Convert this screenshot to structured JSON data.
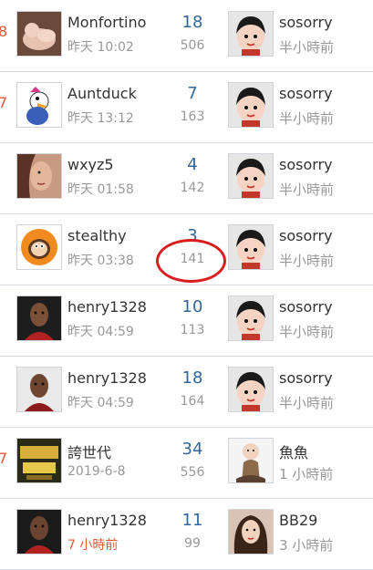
{
  "threads": [
    {
      "author": "Monfortino",
      "date": "昨天 10:02",
      "replies": "18",
      "views": "506",
      "last_user": "sosorry",
      "last_time": "半小時前",
      "edge_mark": "8"
    },
    {
      "author": "Auntduck",
      "date": "昨天 13:12",
      "replies": "7",
      "views": "163",
      "last_user": "sosorry",
      "last_time": "半小時前",
      "edge_mark": "7"
    },
    {
      "author": "wxyz5",
      "date": "昨天 01:58",
      "replies": "4",
      "views": "142",
      "last_user": "sosorry",
      "last_time": "半小時前",
      "edge_mark": ""
    },
    {
      "author": "stealthy",
      "date": "昨天 03:38",
      "replies": "3",
      "views": "141",
      "last_user": "sosorry",
      "last_time": "半小時前",
      "edge_mark": ""
    },
    {
      "author": "henry1328",
      "date": "昨天 04:59",
      "replies": "10",
      "views": "113",
      "last_user": "sosorry",
      "last_time": "半小時前",
      "edge_mark": ""
    },
    {
      "author": "henry1328",
      "date": "昨天 04:59",
      "replies": "18",
      "views": "164",
      "last_user": "sosorry",
      "last_time": "半小時前",
      "edge_mark": ""
    },
    {
      "author": "誇世代",
      "date": "2019-6-8",
      "replies": "34",
      "views": "556",
      "last_user": "魚魚",
      "last_time": "1 小時前",
      "edge_mark": "7"
    },
    {
      "author": "henry1328",
      "date": "7 小時前",
      "replies": "11",
      "views": "99",
      "last_user": "BB29",
      "last_time": "3 小時前",
      "edge_mark": ""
    }
  ],
  "colors": {
    "accent_number": "#336699",
    "muted_text": "#999999",
    "highlight_date": "#e05a3a",
    "annotation_circle": "#d81e1e"
  },
  "annotation": {
    "target": "views of stealthy thread",
    "shape": "red hand-drawn ellipse"
  }
}
